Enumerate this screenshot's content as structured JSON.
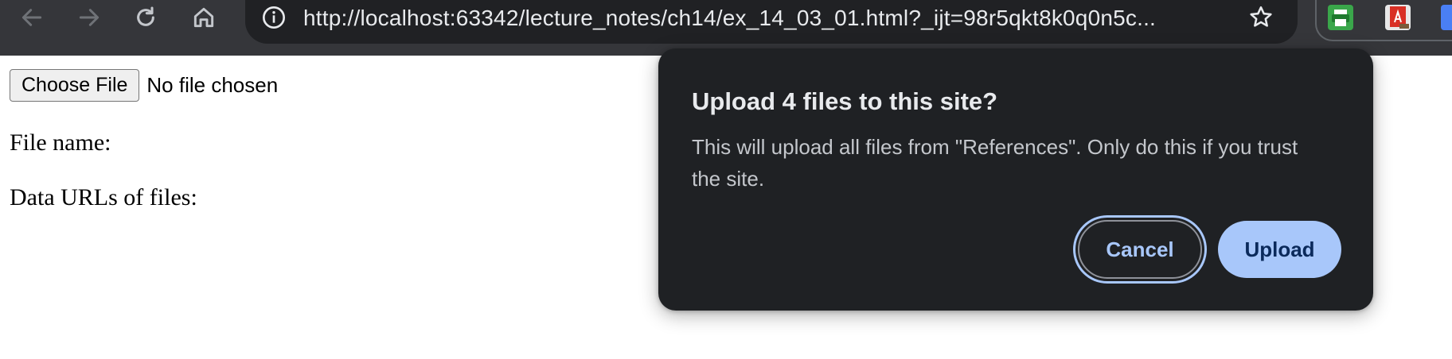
{
  "browser": {
    "url": "http://localhost:63342/lecture_notes/ch14/ex_14_03_01.html?_ijt=98r5qkt8k0q0n5c...",
    "nav_icons": [
      "back-arrow-icon",
      "forward-arrow-icon",
      "reload-icon",
      "home-icon"
    ],
    "omnibox_icons": [
      "info-icon",
      "star-icon"
    ],
    "extensions": [
      "printer-extension-icon",
      "pdf-extension-icon",
      "google-extension-icon"
    ]
  },
  "page": {
    "choose_file_label": "Choose File",
    "file_status": "No file chosen",
    "file_name_label": "File name:",
    "data_urls_label": "Data URLs of files:"
  },
  "dialog": {
    "title": "Upload 4 files to this site?",
    "body": "This will upload all files from \"References\". Only do this if you trust the site.",
    "cancel_label": "Cancel",
    "upload_label": "Upload"
  },
  "colors": {
    "toolbar_bg": "#35363a",
    "omnibox_bg": "#202124",
    "dialog_bg": "#1f2124",
    "accent": "#a8c7fa",
    "upload_text": "#0b2a5b"
  }
}
